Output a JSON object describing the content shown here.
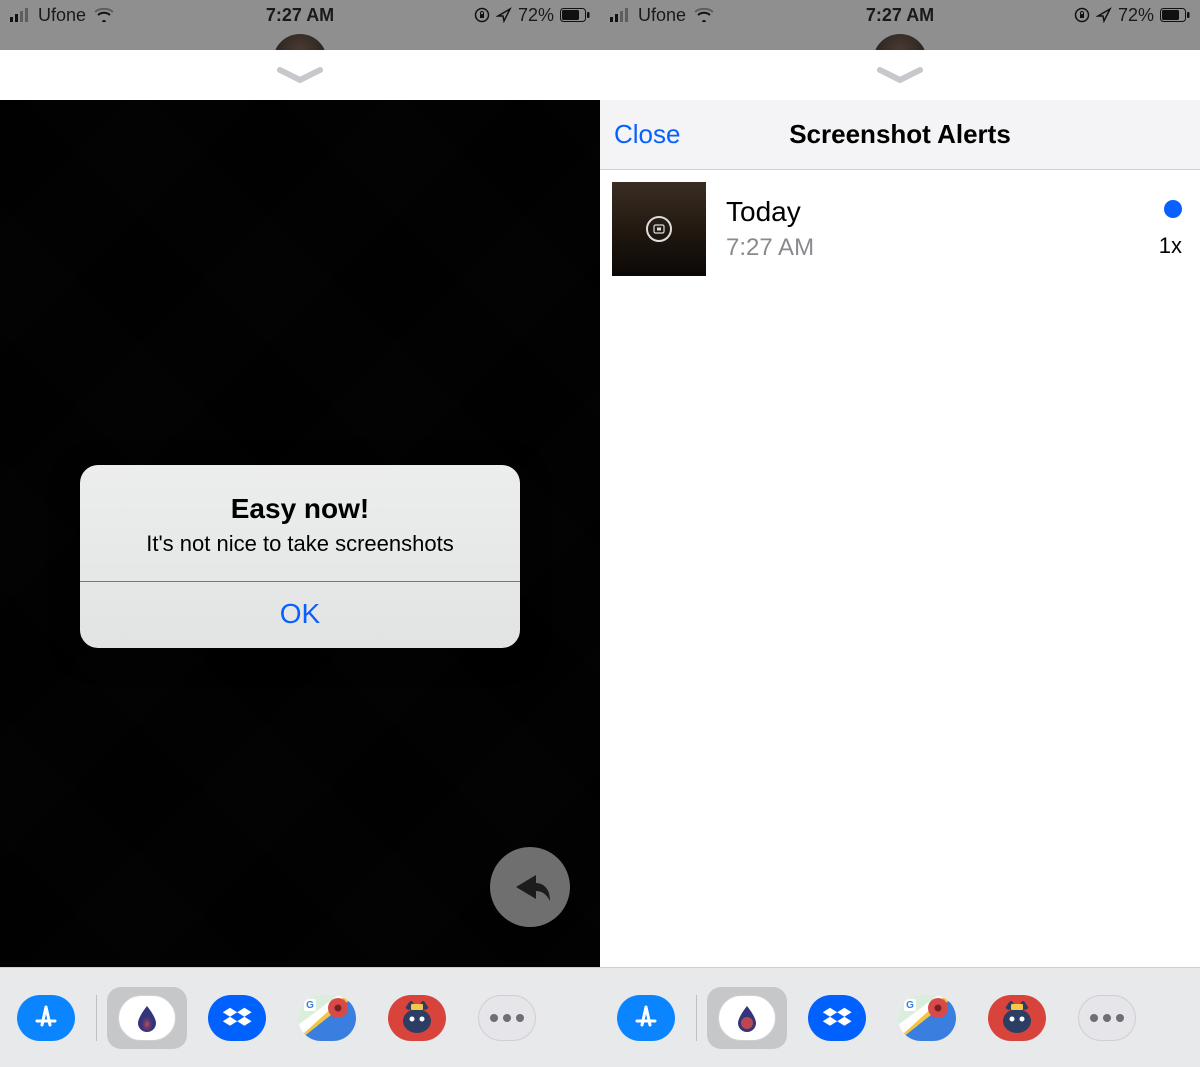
{
  "status_bar": {
    "carrier": "Ufone",
    "time": "7:27 AM",
    "battery_percent": "72%"
  },
  "left_screen": {
    "alert": {
      "title": "Easy now!",
      "message": "It's not nice to take screenshots",
      "button": "OK"
    }
  },
  "right_screen": {
    "header": {
      "close_label": "Close",
      "title": "Screenshot Alerts"
    },
    "alerts": [
      {
        "title": "Today",
        "time": "7:27 AM",
        "count": "1x",
        "unread": true
      }
    ]
  },
  "app_drawer": {
    "apps": [
      {
        "name": "app-store"
      },
      {
        "name": "screenshot-app",
        "selected": true
      },
      {
        "name": "dropbox"
      },
      {
        "name": "google-maps"
      },
      {
        "name": "cat-game"
      },
      {
        "name": "more"
      }
    ]
  }
}
